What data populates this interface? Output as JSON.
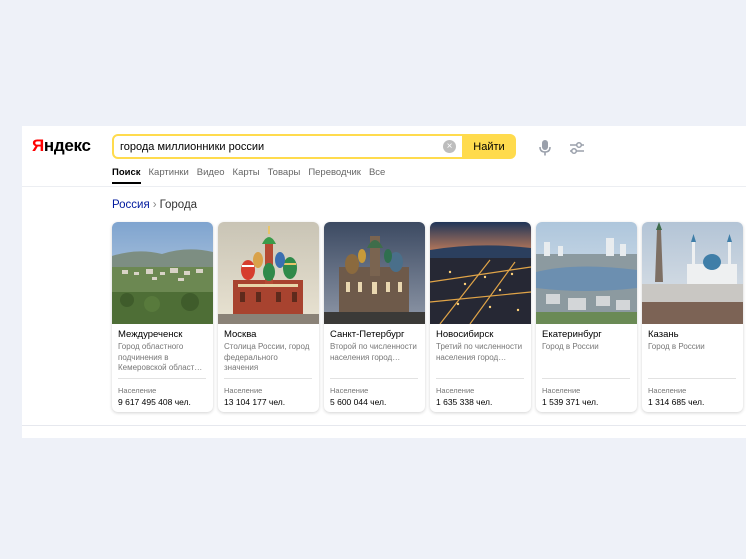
{
  "logo": {
    "first": "Я",
    "rest": "ндекс"
  },
  "search": {
    "query": "города миллионники россии",
    "button_label": "Найти",
    "clear_symbol": "×"
  },
  "tabs": [
    {
      "label": "Поиск",
      "active": true
    },
    {
      "label": "Картинки"
    },
    {
      "label": "Видео"
    },
    {
      "label": "Карты"
    },
    {
      "label": "Товары"
    },
    {
      "label": "Переводчик"
    },
    {
      "label": "Все"
    }
  ],
  "breadcrumb": {
    "root": "Россия",
    "separator": "›",
    "current": "Города"
  },
  "population_label": "Население",
  "cities": [
    {
      "name": "Междуреченск",
      "desc": "Город областного подчинения в Кемеровской област…",
      "population": "9 617 495 408 чел."
    },
    {
      "name": "Москва",
      "desc": "Столица России, город федерального значения",
      "population": "13 104 177 чел."
    },
    {
      "name": "Санкт-Петербург",
      "desc": "Второй по численности населения город…",
      "population": "5 600 044 чел."
    },
    {
      "name": "Новосибирск",
      "desc": "Третий по численности населения город…",
      "population": "1 635 338 чел."
    },
    {
      "name": "Екатеринбург",
      "desc": "Город в России",
      "population": "1 539 371 чел."
    },
    {
      "name": "Казань",
      "desc": "Город в России",
      "population": "1 314 685 чел."
    }
  ],
  "icons": {
    "mic": "microphone-icon",
    "settings": "sliders-icon",
    "clear": "clear-icon"
  },
  "colors": {
    "accent": "#ffdb4d",
    "logo_red": "#ff0000",
    "link": "#001a9e",
    "page_bg": "#eef1f8"
  }
}
